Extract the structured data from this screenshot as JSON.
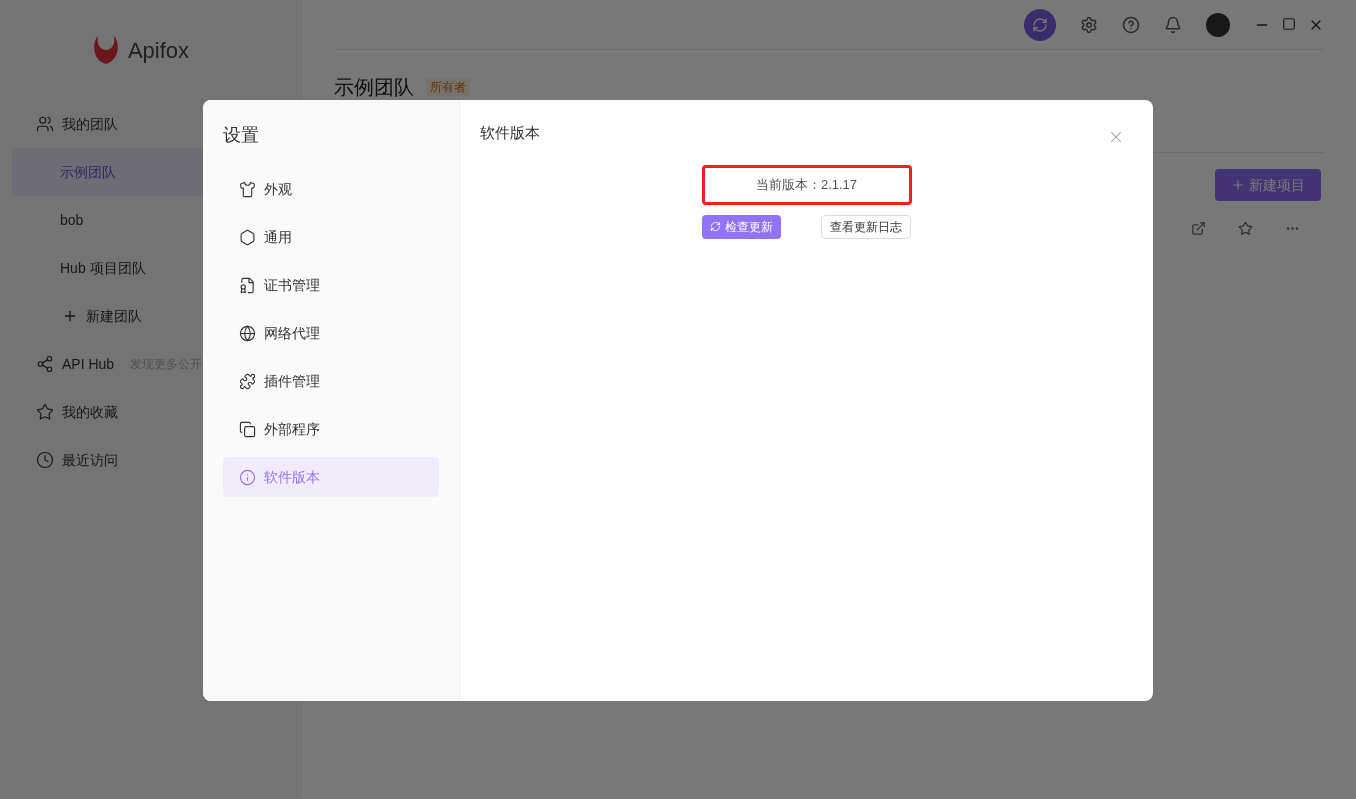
{
  "app": {
    "logo_text": "Apifox",
    "sidebar": [
      {
        "kind": "section",
        "label": "我的团队"
      },
      {
        "kind": "team",
        "label": "示例团队",
        "selected": true
      },
      {
        "kind": "team",
        "label": "bob",
        "selected": false
      },
      {
        "kind": "team",
        "label": "Hub 项目团队",
        "selected": false
      },
      {
        "kind": "action",
        "label": "新建团队"
      },
      {
        "kind": "section",
        "label": "API Hub",
        "hint": "发现更多公开"
      },
      {
        "kind": "section",
        "label": "我的收藏"
      },
      {
        "kind": "section",
        "label": "最近访问"
      }
    ],
    "team_title": "示例团队",
    "role_badge": "所有者",
    "new_project_button": "新建项目"
  },
  "dialog": {
    "title": "设置",
    "nav": [
      {
        "label": "外观",
        "selected": false
      },
      {
        "label": "通用",
        "selected": false
      },
      {
        "label": "证书管理",
        "selected": false
      },
      {
        "label": "网络代理",
        "selected": false
      },
      {
        "label": "插件管理",
        "selected": false
      },
      {
        "label": "外部程序",
        "selected": false
      },
      {
        "label": "软件版本",
        "selected": true
      }
    ],
    "section_title": "软件版本",
    "version": "当前版本：2.1.17",
    "version_highlighted": true,
    "check_update_button": "检查更新",
    "changelog_button": "查看更新日志"
  }
}
